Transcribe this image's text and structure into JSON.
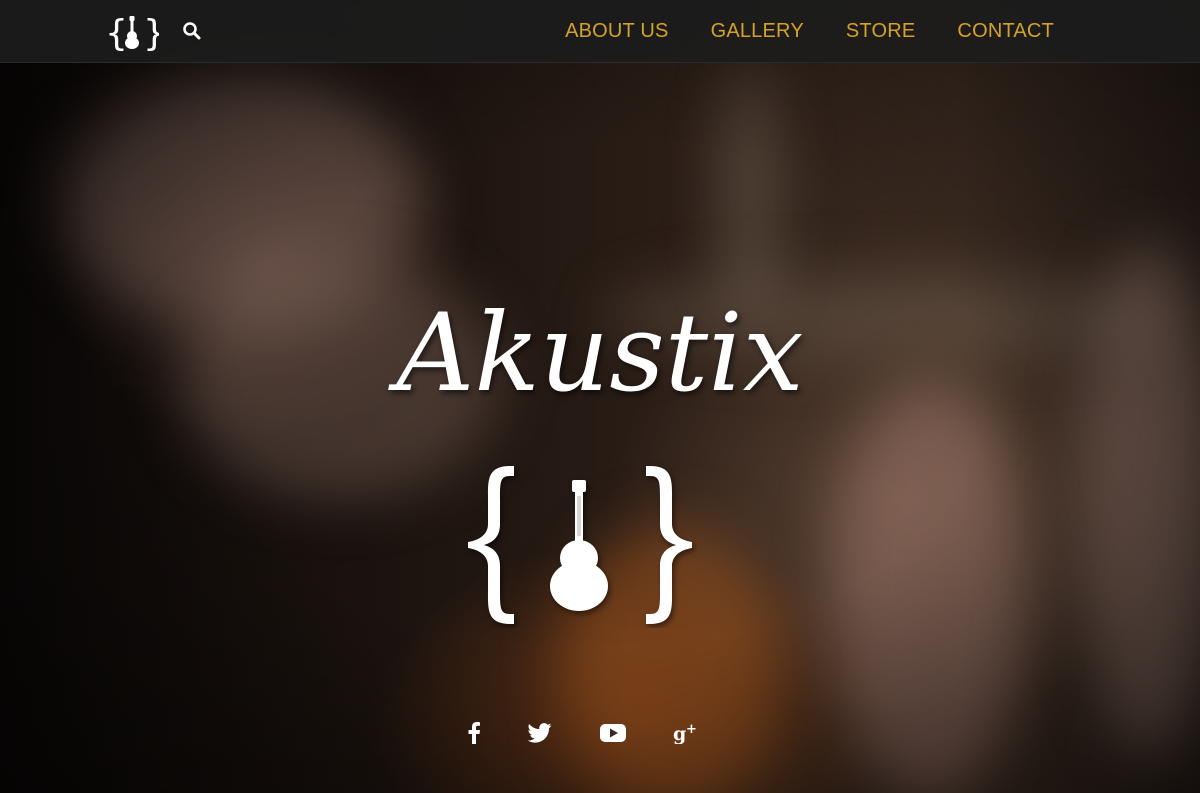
{
  "brand": {
    "site_name": "Akustix"
  },
  "nav": {
    "items": [
      {
        "label": "ABOUT US"
      },
      {
        "label": "GALLERY"
      },
      {
        "label": "STORE"
      },
      {
        "label": "CONTACT"
      }
    ],
    "search_icon": "search-icon",
    "link_color": "#d4a22b"
  },
  "hero": {
    "title": "Akustix",
    "logo_icon": "guitar-braces-logo"
  },
  "social": {
    "icons": [
      "facebook-icon",
      "twitter-icon",
      "youtube-icon",
      "google-plus-icon"
    ]
  }
}
